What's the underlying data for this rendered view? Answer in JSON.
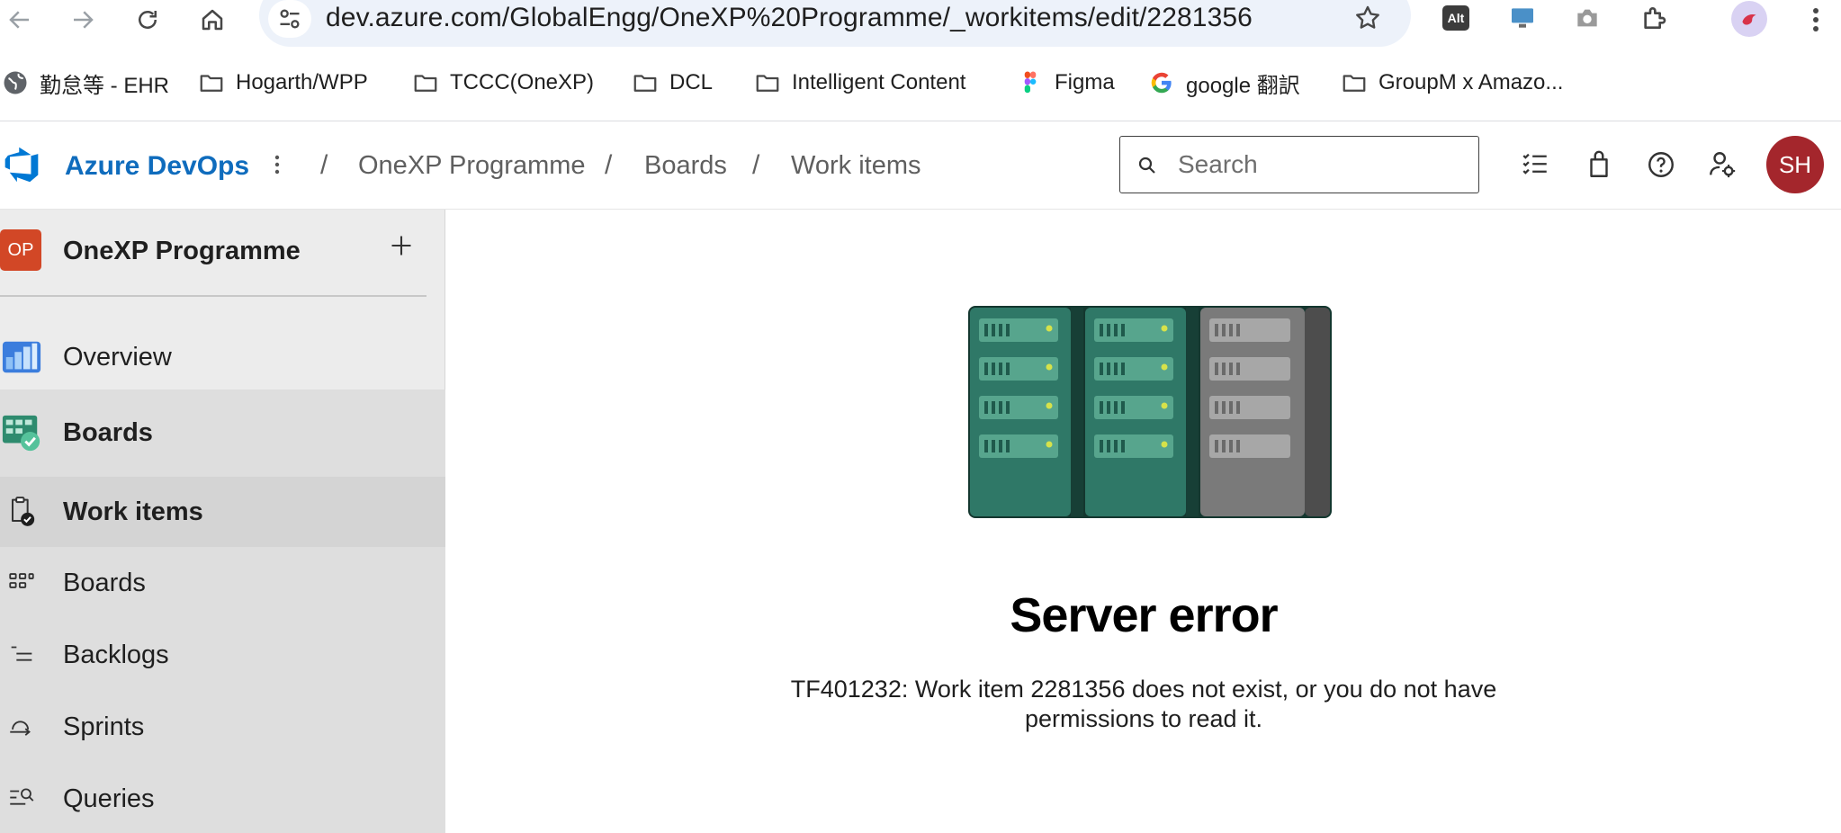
{
  "browser": {
    "url": "dev.azure.com/GlobalEngg/OneXP%20Programme/_workitems/edit/2281356",
    "alt_extension_label": "Alt"
  },
  "bookmarks": [
    {
      "label": "勤怠等 - EHR",
      "icon": "globe-icon"
    },
    {
      "label": "Hogarth/WPP",
      "icon": "folder-icon"
    },
    {
      "label": "TCCC(OneXP)",
      "icon": "folder-icon"
    },
    {
      "label": "DCL",
      "icon": "folder-icon"
    },
    {
      "label": "Intelligent Content",
      "icon": "folder-icon"
    },
    {
      "label": "Figma",
      "icon": "figma-icon"
    },
    {
      "label": "google 翻訳",
      "icon": "google-icon"
    },
    {
      "label": "GroupM x Amazo...",
      "icon": "folder-icon"
    }
  ],
  "header": {
    "brand": "Azure DevOps",
    "breadcrumbs": [
      "OneXP Programme",
      "Boards",
      "Work items"
    ],
    "search_placeholder": "Search",
    "avatar_initials": "SH",
    "avatar_color": "#a4262c",
    "brand_color": "#0f6cbd"
  },
  "sidebar": {
    "project_badge": "OP",
    "project_badge_color": "#d24726",
    "project_name": "OneXP Programme",
    "items": [
      {
        "label": "Overview",
        "icon": "overview-icon"
      },
      {
        "label": "Boards",
        "icon": "boards-hub-icon"
      },
      {
        "label": "Work items",
        "icon": "work-items-icon"
      },
      {
        "label": "Boards",
        "icon": "boards-icon"
      },
      {
        "label": "Backlogs",
        "icon": "backlogs-icon"
      },
      {
        "label": "Sprints",
        "icon": "sprints-icon"
      },
      {
        "label": "Queries",
        "icon": "queries-icon"
      }
    ]
  },
  "error": {
    "title": "Server error",
    "message": "TF401232: Work item 2281356 does not exist, or you do not have permissions to read it."
  }
}
